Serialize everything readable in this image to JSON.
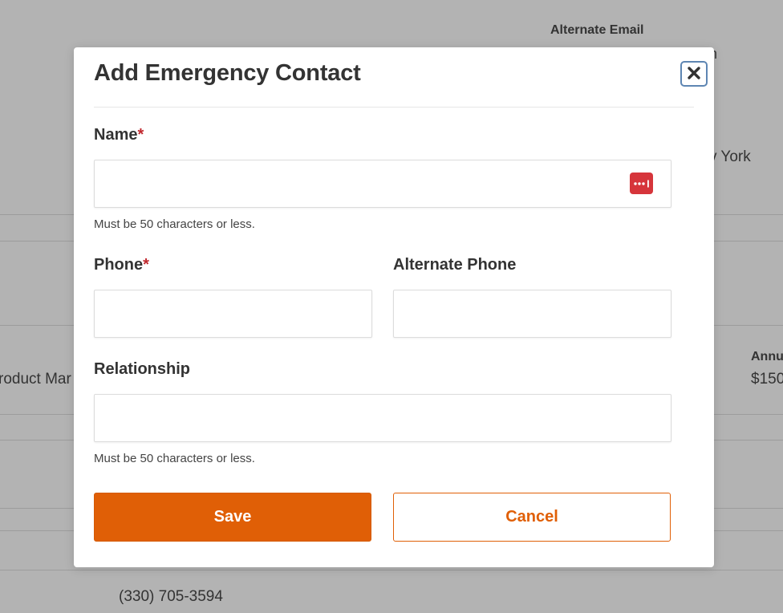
{
  "background": {
    "alternate_email_header": "Alternate Email",
    "clipped_n": "n",
    "location_fragment": "v York",
    "annual_fragment": "Annu",
    "salary_fragment": "$150",
    "title_fragment": "roduct Mar",
    "phone_value": "(330) 705-3594"
  },
  "modal": {
    "title": "Add Emergency Contact",
    "close_icon": "close-x-icon",
    "name": {
      "label": "Name",
      "required_marker": "*",
      "value": "",
      "hint": "Must be 50 characters or less."
    },
    "password_manager_icon": "password-manager-icon",
    "phone": {
      "label": "Phone",
      "required_marker": "*",
      "value": ""
    },
    "alternate_phone": {
      "label": "Alternate Phone",
      "value": ""
    },
    "relationship": {
      "label": "Relationship",
      "value": "",
      "hint": "Must be 50 characters or less."
    },
    "save_label": "Save",
    "cancel_label": "Cancel"
  },
  "colors": {
    "accent": "#e05f06",
    "required": "#c0272d",
    "overlay": "#b3b3b3",
    "close_border": "#5e86b3",
    "password_icon": "#d6353b"
  }
}
